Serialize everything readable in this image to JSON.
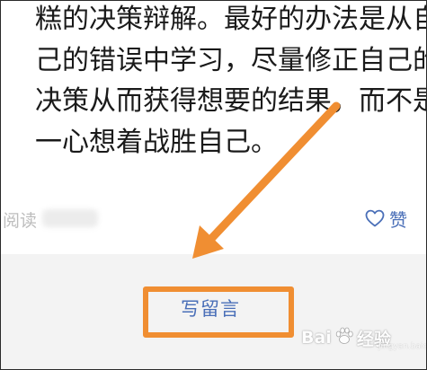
{
  "article": {
    "lines": [
      "糕的决策辩解。最好的办法是从自",
      "己的错误中学习，尽量修正自己的",
      "决策从而获得想要的结果，而不是",
      "一心想着战胜自己。"
    ]
  },
  "meta": {
    "read_label": "阅读",
    "like_label": "赞",
    "like_icon": "heart-outline-icon"
  },
  "footer": {
    "write_comment_label": "写留言"
  },
  "annotation": {
    "highlight_color": "#f08e32"
  },
  "watermark": {
    "brand_left": "Bai",
    "brand_right": "经验",
    "domain": "jingyan.baidu.com"
  },
  "colors": {
    "link_blue": "#4a6fb8",
    "footer_bg": "#f3f3f3",
    "body_text": "#1a1a1a"
  }
}
